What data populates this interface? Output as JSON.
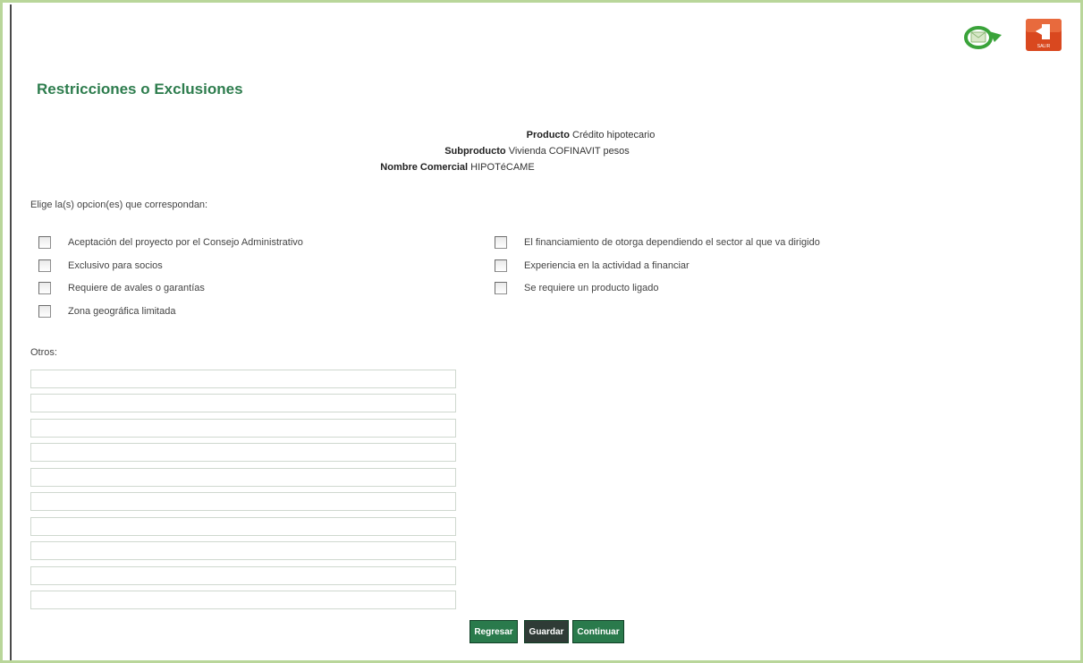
{
  "page": {
    "title": "Restricciones o Exclusiones"
  },
  "product_info": {
    "producto_label": "Producto",
    "producto_value": "Crédito hipotecario",
    "subproducto_label": "Subproducto",
    "subproducto_value": "Vivienda COFINAVIT pesos",
    "nombre_label": "Nombre Comercial",
    "nombre_value": "HIPOTéCAME"
  },
  "prompt": "Elige la(s) opcion(es) que correspondan:",
  "options_left": [
    {
      "label": "Aceptación del proyecto por el Consejo Administrativo",
      "checked": false
    },
    {
      "label": "Exclusivo para socios",
      "checked": false
    },
    {
      "label": "Requiere de avales o garantías",
      "checked": false
    },
    {
      "label": "Zona geográfica limitada",
      "checked": false
    }
  ],
  "options_right": [
    {
      "label": "El financiamiento de otorga dependiendo el sector al que va dirigido",
      "checked": false
    },
    {
      "label": "Experiencia en la actividad a financiar",
      "checked": false
    },
    {
      "label": "Se requiere un producto ligado",
      "checked": false
    }
  ],
  "otros_label": "Otros:",
  "otros_fields": [
    "",
    "",
    "",
    "",
    "",
    "",
    "",
    "",
    "",
    ""
  ],
  "buttons": {
    "regresar": "Regresar",
    "guardar": "Guardar",
    "continuar": "Continuar"
  },
  "icons": {
    "mail": "mail-send-icon",
    "exit": "exit-icon",
    "exit_label": "SALIR"
  },
  "colors": {
    "accent_green": "#2e7d4e",
    "button_green": "#2a7a4c",
    "button_dark": "#2f3b36",
    "exit_red": "#d9481f"
  }
}
